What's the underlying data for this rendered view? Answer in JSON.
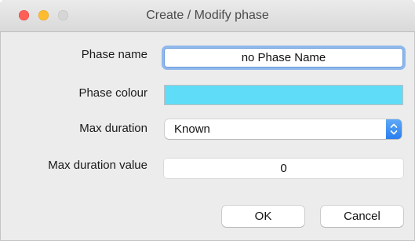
{
  "window": {
    "title": "Create / Modify phase"
  },
  "form": {
    "phase_name_label": "Phase name",
    "phase_name_value": "no Phase Name",
    "phase_colour_label": "Phase colour",
    "phase_colour_value": "#5fdcf7",
    "max_duration_label": "Max duration",
    "max_duration_selected": "Known",
    "max_duration_value_label": "Max duration value",
    "max_duration_value": "0"
  },
  "buttons": {
    "ok_label": "OK",
    "cancel_label": "Cancel"
  },
  "colors": {
    "accent": "#2a7ef0",
    "focus_ring": "#8fb8ec"
  }
}
